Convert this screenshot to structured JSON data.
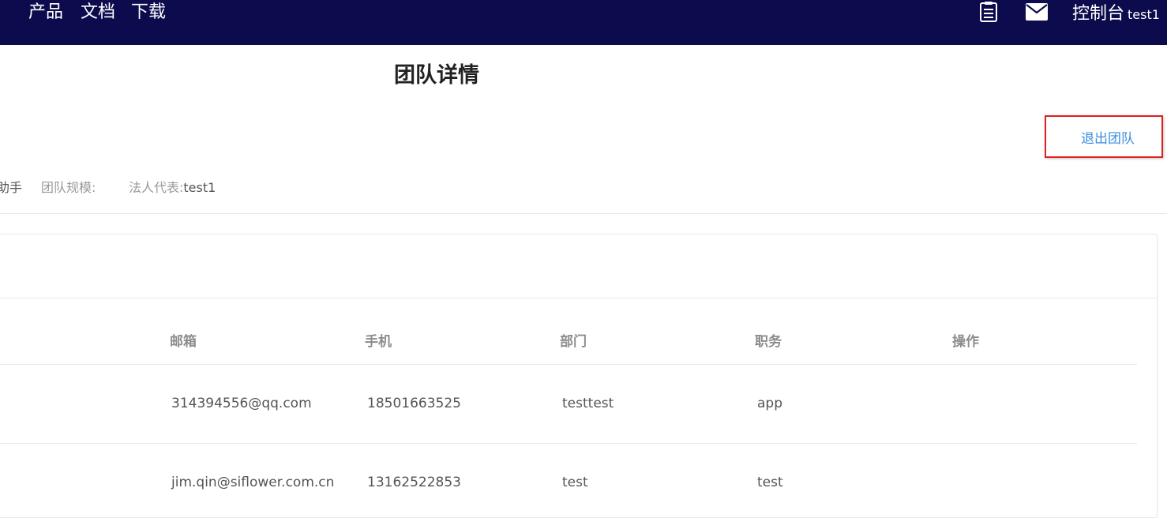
{
  "header": {
    "nav": [
      "产品",
      "文档",
      "下载"
    ],
    "icons": [
      "clipboard-icon",
      "mail-icon"
    ],
    "console_label": "控制台",
    "username": "test1",
    "background": "#0b0b4d"
  },
  "page": {
    "title": "团队详情",
    "exit_button": "退出团队",
    "info": {
      "truncated_name": "助手",
      "scale_label": "团队规模:",
      "scale_value": "",
      "legal_rep_label": "法人代表:",
      "legal_rep_value": "test1"
    }
  },
  "table": {
    "columns": [
      "邮箱",
      "手机",
      "部门",
      "职务",
      "操作"
    ],
    "rows": [
      {
        "email": "314394556@qq.com",
        "phone": "18501663525",
        "dept": "testtest",
        "title": "app",
        "ops": ""
      },
      {
        "email": "jim.qin@siflower.com.cn",
        "phone": "13162522853",
        "dept": "test",
        "title": "test",
        "ops": ""
      }
    ]
  },
  "colors": {
    "link": "#3c8de0",
    "highlight_border": "#e0201e"
  }
}
